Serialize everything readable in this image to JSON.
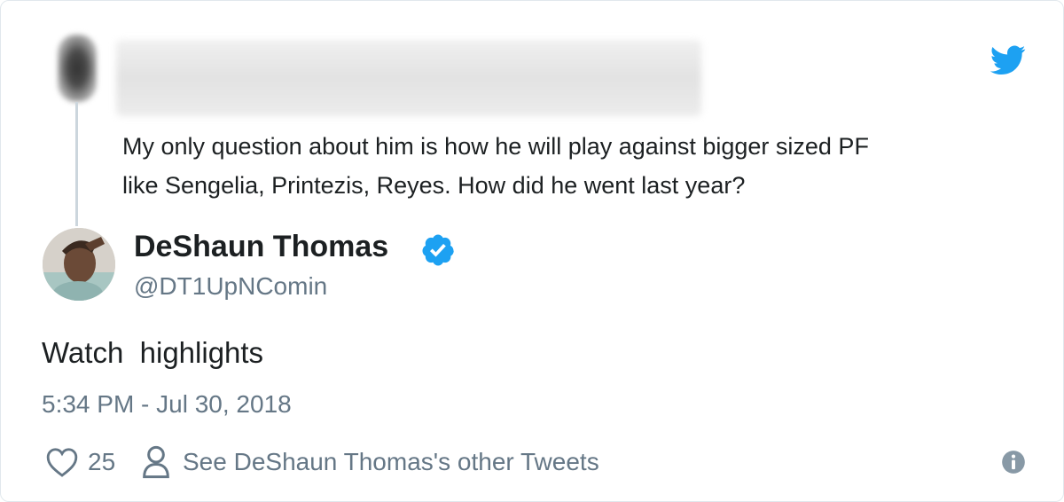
{
  "reply": {
    "text_line1": "My only question about him is how he will play against bigger sized PF",
    "text_line2": "like Sengelia, Printezis, Reyes. How did he went last year?"
  },
  "author": {
    "name": "DeShaun Thomas",
    "handle": "@DT1UpNComin",
    "verified": true
  },
  "tweet": {
    "text": "Watch  highlights",
    "timestamp": "5:34 PM - Jul 30, 2018"
  },
  "actions": {
    "likes": "25",
    "other_tweets_label": "See DeShaun Thomas's other Tweets"
  },
  "colors": {
    "twitter_blue": "#1da1f2",
    "secondary_text": "#657786",
    "thread_line": "#ccd6dd"
  },
  "icons": [
    "twitter-bird-icon",
    "verified-badge-icon",
    "heart-icon",
    "person-icon",
    "info-icon"
  ]
}
